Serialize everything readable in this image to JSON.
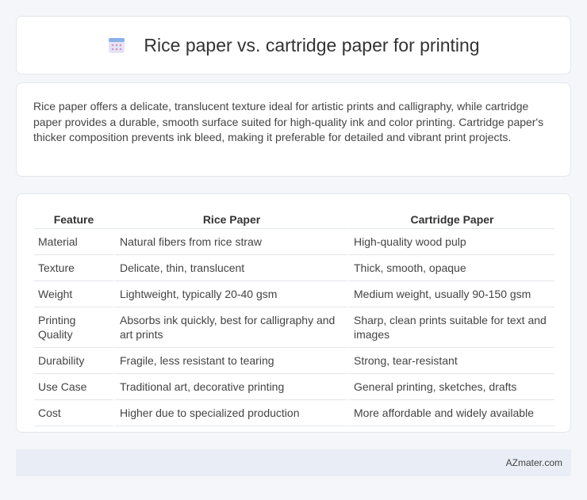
{
  "header": {
    "title": "Rice paper vs. cartridge paper for printing",
    "icon": "calendar-icon"
  },
  "summary": {
    "text": "Rice paper offers a delicate, translucent texture ideal for artistic prints and calligraphy, while cartridge paper provides a durable, smooth surface suited for high-quality ink and color printing. Cartridge paper's thicker composition prevents ink bleed, making it preferable for detailed and vibrant print projects."
  },
  "table": {
    "headers": [
      "Feature",
      "Rice Paper",
      "Cartridge Paper"
    ],
    "rows": [
      [
        "Material",
        "Natural fibers from rice straw",
        "High-quality wood pulp"
      ],
      [
        "Texture",
        "Delicate, thin, translucent",
        "Thick, smooth, opaque"
      ],
      [
        "Weight",
        "Lightweight, typically 20-40 gsm",
        "Medium weight, usually 90-150 gsm"
      ],
      [
        "Printing Quality",
        "Absorbs ink quickly, best for calligraphy and art prints",
        "Sharp, clean prints suitable for text and images"
      ],
      [
        "Durability",
        "Fragile, less resistant to tearing",
        "Strong, tear-resistant"
      ],
      [
        "Use Case",
        "Traditional art, decorative printing",
        "General printing, sketches, drafts"
      ],
      [
        "Cost",
        "Higher due to specialized production",
        "More affordable and widely available"
      ]
    ]
  },
  "footer": {
    "text": "AZmater.com"
  }
}
